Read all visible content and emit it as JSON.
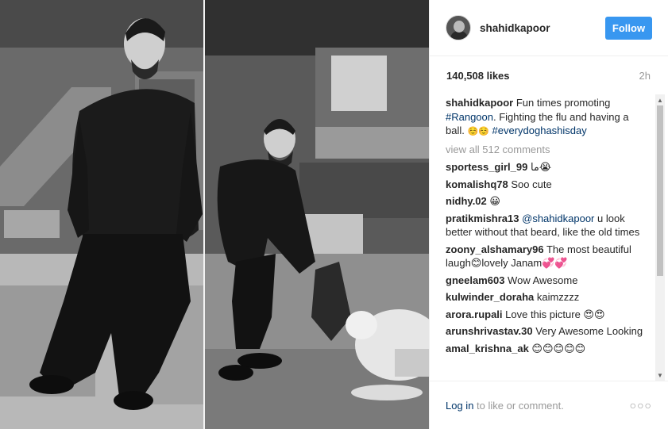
{
  "header": {
    "username": "shahidkapoor",
    "follow_label": "Follow"
  },
  "stats": {
    "likes": "140,508 likes",
    "time": "2h"
  },
  "caption": {
    "username": "shahidkapoor",
    "text_1": " Fun times promoting ",
    "hashtag_1": "#Rangoon",
    "text_2": ". Fighting the flu and having a ball. ",
    "emoji": "☺️☺️",
    "hashtag_2": "#everydoghashisday"
  },
  "view_all": "view all 512 comments",
  "comments": [
    {
      "user": "sportess_girl_99",
      "text": " ما😭"
    },
    {
      "user": "komalishq78",
      "text": " Soo cute"
    },
    {
      "user": "nidhy.02",
      "text": " 😀"
    },
    {
      "user": "pratikmishra13",
      "mention": "@shahidkapoor",
      "text": " u look better without that beard, like the old times"
    },
    {
      "user": "zoony_alshamary96",
      "text": " The most beautiful laugh😊lovely Janam💞💞"
    },
    {
      "user": "gneelam603",
      "text": " Wow Awesome"
    },
    {
      "user": "kulwinder_doraha",
      "text": " kaimzzzz"
    },
    {
      "user": "arora.rupali",
      "text": " Love this picture 😍😍"
    },
    {
      "user": "arunshrivastav.30",
      "text": " Very Awesome Looking"
    },
    {
      "user": "amal_krishna_ak",
      "text": " 😊😊😊😊😊"
    }
  ],
  "footer": {
    "login_label": "Log in",
    "rest": " to like or comment.",
    "more_label": "○○○"
  },
  "colors": {
    "accent": "#3897f0",
    "link": "#003569",
    "muted": "#999999"
  }
}
